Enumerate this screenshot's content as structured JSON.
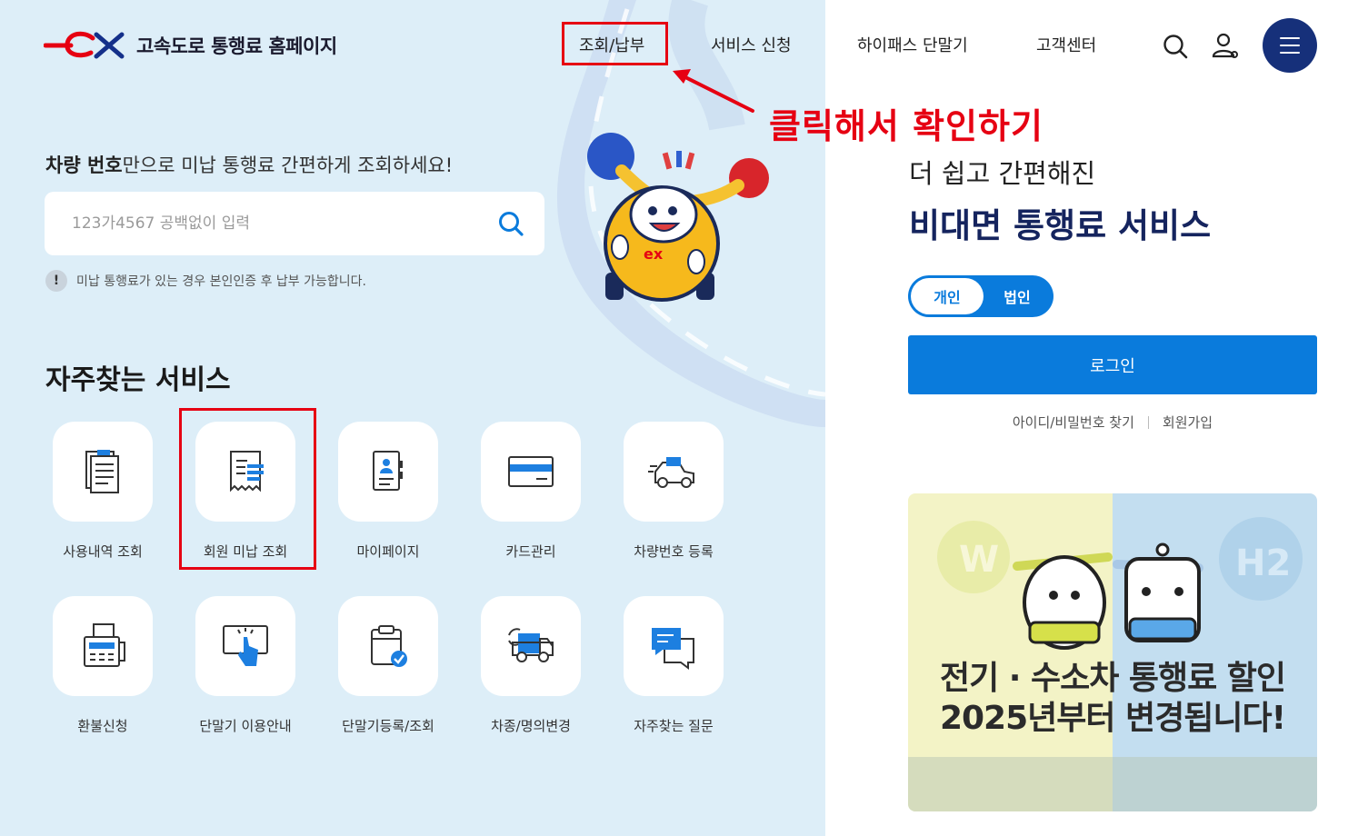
{
  "header": {
    "logo_text": "고속도로 통행료 홈페이지",
    "nav": [
      {
        "label": "조회/납부"
      },
      {
        "label": "서비스 신청"
      },
      {
        "label": "하이패스 단말기"
      },
      {
        "label": "고객센터"
      }
    ]
  },
  "annotation": {
    "text": "클릭해서 확인하기",
    "color": "#e60012"
  },
  "search": {
    "title_bold": "차량 번호",
    "title_rest": "만으로 미납 통행료 간편하게 조회하세요!",
    "placeholder": "123가4567 공백없이 입력",
    "notice_icon": "!",
    "notice": "미납 통행료가 있는 경우 본인인증 후 납부 가능합니다."
  },
  "services": {
    "title": "자주찾는 서비스",
    "items": [
      {
        "label": "사용내역 조회",
        "icon": "document-list-icon"
      },
      {
        "label": "회원 미납 조회",
        "icon": "receipt-icon"
      },
      {
        "label": "마이페이지",
        "icon": "profile-card-icon"
      },
      {
        "label": "카드관리",
        "icon": "credit-card-icon"
      },
      {
        "label": "차량번호 등록",
        "icon": "car-icon"
      },
      {
        "label": "환불신청",
        "icon": "fax-icon"
      },
      {
        "label": "단말기 이용안내",
        "icon": "touch-screen-icon"
      },
      {
        "label": "단말기등록/조회",
        "icon": "device-check-icon"
      },
      {
        "label": "차종/명의변경",
        "icon": "truck-exchange-icon"
      },
      {
        "label": "자주찾는 질문",
        "icon": "chat-icon"
      }
    ]
  },
  "promo": {
    "subtitle": "더 쉽고 간편해진",
    "title": "비대면 통행료 서비스"
  },
  "login": {
    "toggle": [
      "개인",
      "법인"
    ],
    "button": "로그인",
    "links": [
      "아이디/비밀번호 찾기",
      "회원가입"
    ]
  },
  "banner": {
    "line1": "전기 · 수소차 통행료 할인",
    "line2": "2025년부터 변경됩니다!"
  },
  "colors": {
    "brand_blue": "#0a7bdc",
    "navy": "#15245e",
    "highlight_red": "#e60012"
  }
}
